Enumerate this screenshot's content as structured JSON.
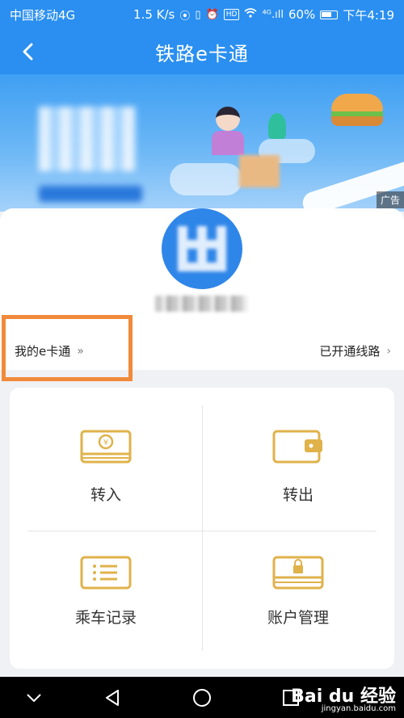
{
  "status_bar": {
    "carrier": "中国移动4G",
    "speed": "1.5 K/s",
    "hd": "HD",
    "signal": "⁴ᴳ.ıll",
    "battery_percent": "60%",
    "time": "下午4:19"
  },
  "nav": {
    "title": "铁路e卡通"
  },
  "banner": {
    "ad_label": "广告"
  },
  "links": {
    "my_card": "我的e卡通",
    "my_card_chevron": "»",
    "opened_lines": "已开通线路",
    "opened_lines_chevron": "›"
  },
  "actions": [
    {
      "label": "转入",
      "icon": "transfer-in-card-icon"
    },
    {
      "label": "转出",
      "icon": "wallet-icon"
    },
    {
      "label": "乘车记录",
      "icon": "ride-record-list-icon"
    },
    {
      "label": "账户管理",
      "icon": "account-lock-card-icon"
    }
  ],
  "watermark": {
    "brand": "Bai du 经验",
    "site": "jingyan.baidu.com"
  },
  "colors": {
    "primary_blue": "#2a8ff0",
    "gold_icon": "#e0b24a",
    "highlight_orange": "#f08a3a"
  }
}
